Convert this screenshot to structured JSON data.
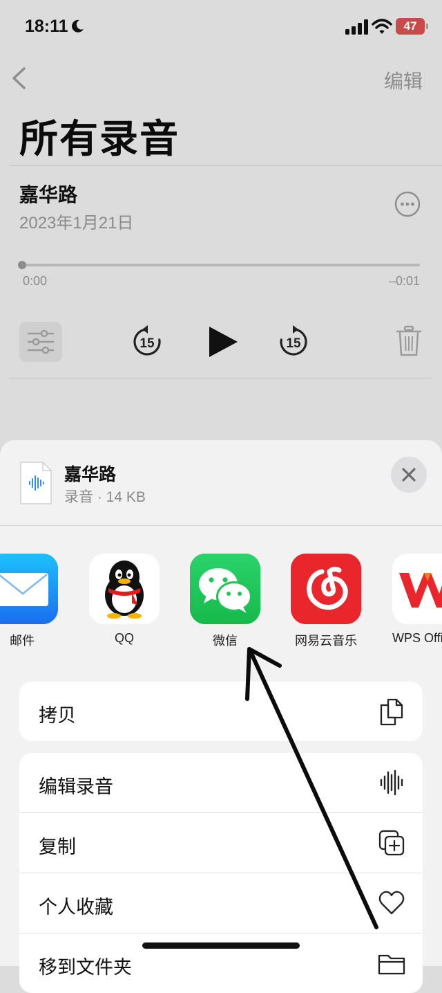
{
  "status_bar": {
    "time": "18:11",
    "battery": "47"
  },
  "nav": {
    "edit_label": "编辑"
  },
  "page": {
    "title": "所有录音"
  },
  "recording": {
    "title": "嘉华路",
    "date": "2023年1月21日",
    "time_elapsed": "0:00",
    "time_remaining": "–0:01",
    "skip_back_seconds": "15",
    "skip_forward_seconds": "15",
    "progress": 0
  },
  "share_sheet": {
    "file_title": "嘉华路",
    "file_subtitle": "录音 · 14 KB",
    "apps": [
      {
        "label": "邮件",
        "icon": "mail-icon",
        "color": "#1e8cf7"
      },
      {
        "label": "QQ",
        "icon": "qq-penguin-icon",
        "color": "#ffffff"
      },
      {
        "label": "微信",
        "icon": "wechat-icon",
        "color": "#1ec456"
      },
      {
        "label": "网易云音乐",
        "icon": "netease-music-icon",
        "color": "#e8262b"
      },
      {
        "label": "WPS Office",
        "icon": "wps-icon",
        "color": "#ffffff"
      }
    ],
    "actions_group1": [
      {
        "label": "拷贝",
        "icon": "copy-icon"
      }
    ],
    "actions_group2": [
      {
        "label": "编辑录音",
        "icon": "waveform-icon"
      },
      {
        "label": "复制",
        "icon": "duplicate-icon"
      },
      {
        "label": "个人收藏",
        "icon": "heart-icon"
      },
      {
        "label": "移到文件夹",
        "icon": "folder-icon"
      }
    ]
  },
  "colors": {
    "accent": "#1ec456",
    "background": "#dcdcdc",
    "sheet": "#f2f2f3"
  }
}
